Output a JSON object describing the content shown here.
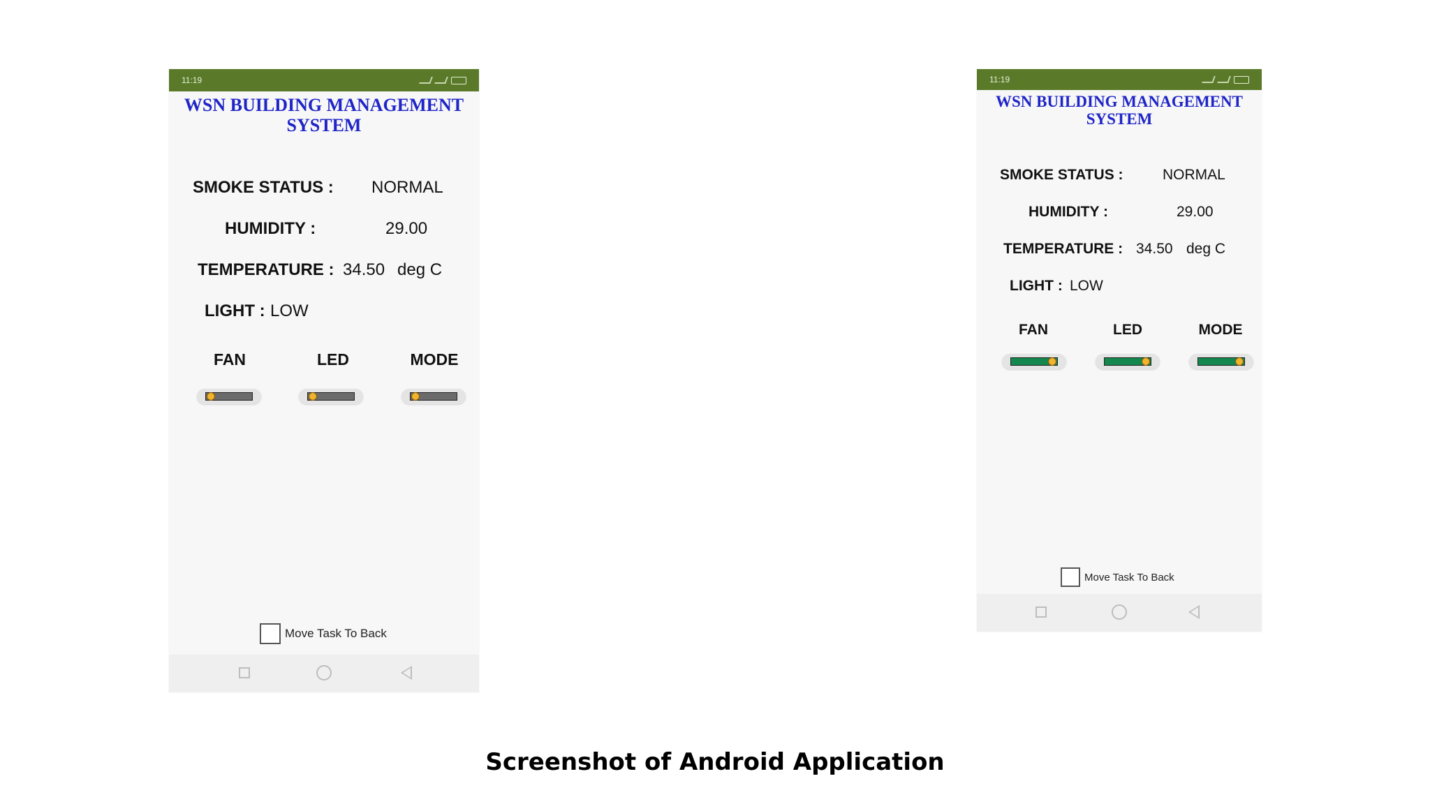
{
  "phones": [
    {
      "status_time": "11:19",
      "title_line1": "WSN BUILDING MANAGEMENT",
      "title_line2": "SYSTEM",
      "smoke_label": "SMOKE STATUS :",
      "smoke_value": "NORMAL",
      "humidity_label": "HUMIDITY :",
      "humidity_value": "29.00",
      "temperature_label": "TEMPERATURE :",
      "temperature_value": "34.50",
      "temperature_unit": "deg C",
      "light_label": "LIGHT :",
      "light_value": "LOW",
      "controls": [
        {
          "label": "FAN",
          "state": "off"
        },
        {
          "label": "LED",
          "state": "off"
        },
        {
          "label": "MODE",
          "state": "off"
        }
      ],
      "checkbox_label": "Move Task To Back",
      "checkbox_checked": false
    },
    {
      "status_time": "11:19",
      "title_line1": "WSN BUILDING MANAGEMENT",
      "title_line2": "SYSTEM",
      "smoke_label": "SMOKE STATUS :",
      "smoke_value": "NORMAL",
      "humidity_label": "HUMIDITY :",
      "humidity_value": "29.00",
      "temperature_label": "TEMPERATURE :",
      "temperature_value": "34.50",
      "temperature_unit": "deg C",
      "light_label": "LIGHT :",
      "light_value": "LOW",
      "controls": [
        {
          "label": "FAN",
          "state": "on"
        },
        {
          "label": "LED",
          "state": "on"
        },
        {
          "label": "MODE",
          "state": "on"
        }
      ],
      "checkbox_label": "Move Task To Back",
      "checkbox_checked": false
    }
  ],
  "caption": "Screenshot of Android Application",
  "colors": {
    "status_bar": "#5a7a2a",
    "title": "#1f25c7",
    "switch_on": "#13874d",
    "switch_off": "#6b6b6b",
    "knob": "#f0b431"
  }
}
